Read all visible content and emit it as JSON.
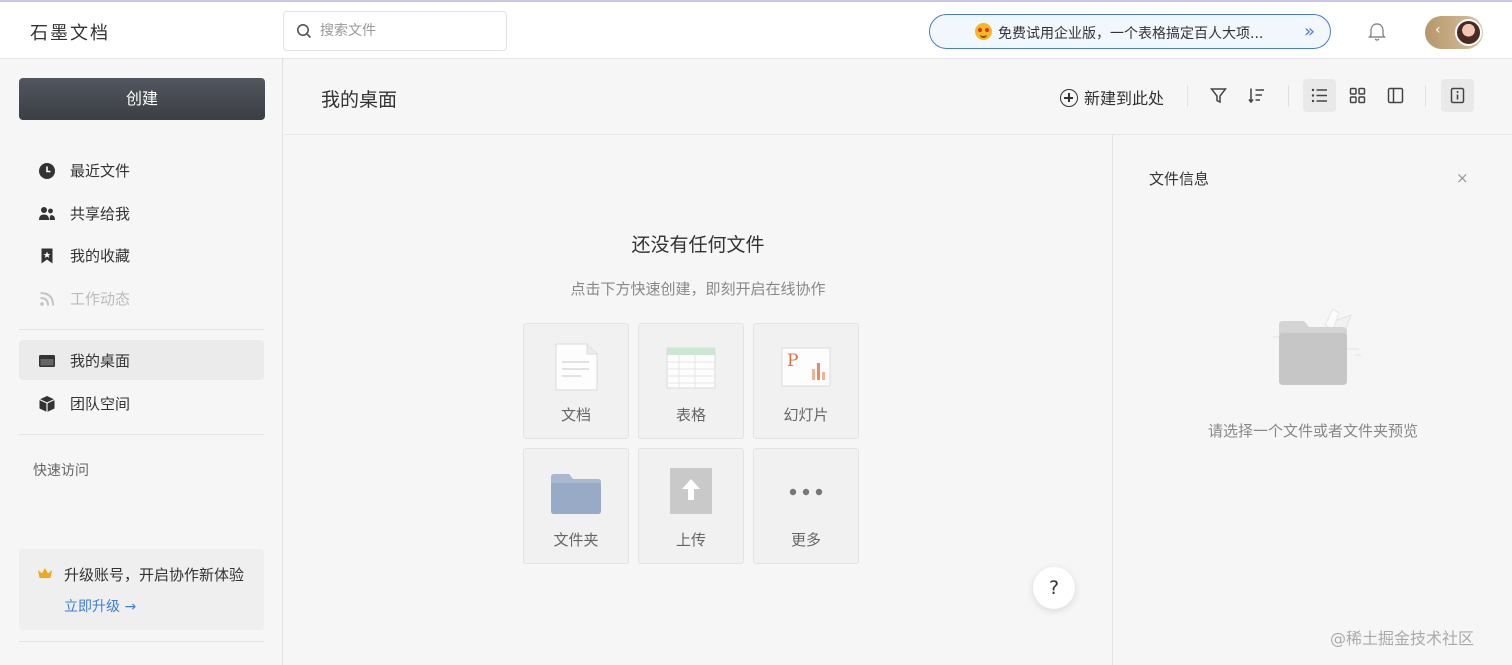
{
  "app": {
    "logo": "石墨文档"
  },
  "search": {
    "placeholder": "搜索文件"
  },
  "promo": {
    "text": "免费试用企业版，一个表格搞定百人大项...",
    "emoji": "star-struck-emoji"
  },
  "sidebar": {
    "create_label": "创建",
    "items": [
      {
        "label": "最近文件",
        "icon": "clock-icon"
      },
      {
        "label": "共享给我",
        "icon": "people-icon"
      },
      {
        "label": "我的收藏",
        "icon": "bookmark-icon"
      },
      {
        "label": "工作动态",
        "icon": "rss-icon"
      },
      {
        "label": "我的桌面",
        "icon": "desktop-icon"
      },
      {
        "label": "团队空间",
        "icon": "cube-icon"
      }
    ],
    "quick_access": "快速访问",
    "upgrade": {
      "title": "升级账号，开启协作新体验",
      "link": "立即升级 →"
    }
  },
  "header": {
    "title": "我的桌面",
    "new_here": "新建到此处"
  },
  "main": {
    "empty_title": "还没有任何文件",
    "empty_subtitle": "点击下方快速创建，即刻开启在线协作",
    "tiles": [
      {
        "label": "文档"
      },
      {
        "label": "表格"
      },
      {
        "label": "幻灯片"
      },
      {
        "label": "文件夹"
      },
      {
        "label": "上传"
      },
      {
        "label": "更多"
      }
    ],
    "help": "?"
  },
  "info_panel": {
    "title": "文件信息",
    "close": "×",
    "tip": "请选择一个文件或者文件夹预览"
  },
  "watermark": "@稀土掘金技术社区",
  "colors": {
    "accent": "#3d7fd6",
    "promo_border": "#4a7bd0",
    "create_button": "#45484f"
  }
}
